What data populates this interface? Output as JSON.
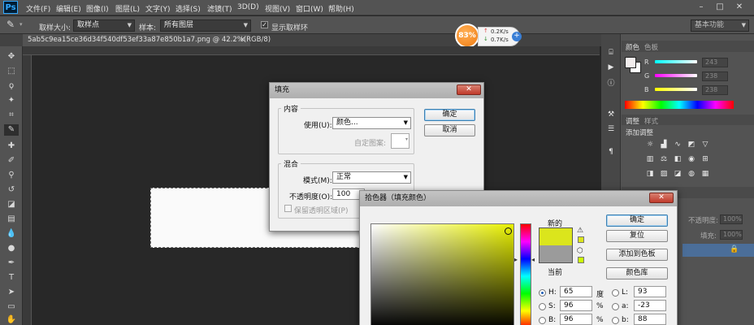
{
  "menubar": {
    "logo": "Ps",
    "items": [
      "文件(F)",
      "编辑(E)",
      "图像(I)",
      "图层(L)",
      "文字(Y)",
      "选择(S)",
      "滤镜(T)",
      "3D(D)",
      "视图(V)",
      "窗口(W)",
      "帮助(H)"
    ],
    "window_controls": [
      "–",
      "□",
      "✕"
    ]
  },
  "options_bar": {
    "sample_size_label": "取样大小:",
    "sample_size_value": "取样点",
    "sample_label": "样本:",
    "sample_value": "所有图层",
    "show_ring_label": "显示取样环",
    "workspace_value": "基本功能"
  },
  "document_tab": {
    "title": "5ab5c9ea15ce36d34f540df53ef33a87e850b1a7.png @ 42.2%(RGB/8)",
    "close": "×"
  },
  "net_widget": {
    "percent": "83%",
    "up": "0.2K/s",
    "down": "0.7K/s",
    "plus": "+"
  },
  "color_panel": {
    "tabs": [
      "颜色",
      "色板"
    ],
    "channels": [
      {
        "name": "R",
        "value": "243"
      },
      {
        "name": "G",
        "value": "238"
      },
      {
        "name": "B",
        "value": "238"
      }
    ]
  },
  "adjust_panel": {
    "tabs": [
      "调整",
      "样式"
    ],
    "title": "添加调整"
  },
  "layers_panel": {
    "opacity_label": "不透明度:",
    "opacity_value": "100%",
    "fill_label": "填充:",
    "fill_value": "100%"
  },
  "fill_dialog": {
    "title": "填充",
    "content_legend": "内容",
    "use_label": "使用(U):",
    "use_value": "颜色...",
    "pattern_label": "自定图案:",
    "blend_legend": "混合",
    "mode_label": "模式(M):",
    "mode_value": "正常",
    "opacity_label": "不透明度(O):",
    "opacity_value": "100",
    "opacity_unit": "%",
    "preserve_label": "保留透明区域(P)",
    "ok": "确定",
    "cancel": "取消"
  },
  "picker_dialog": {
    "title": "拾色器（填充颜色）",
    "new_label": "新的",
    "current_label": "当前",
    "new_color": "#dbe51c",
    "current_color": "#9b9b9b",
    "ok": "确定",
    "reset": "复位",
    "add_swatch": "添加到色板",
    "color_lib": "颜色库",
    "fields": [
      {
        "key": "H:",
        "value": "65",
        "unit": "度",
        "checked": true
      },
      {
        "key": "S:",
        "value": "96",
        "unit": "%",
        "checked": false
      },
      {
        "key": "B:",
        "value": "96",
        "unit": "%",
        "checked": false
      }
    ],
    "lab_fields": [
      {
        "key": "L:",
        "value": "93"
      },
      {
        "key": "a:",
        "value": "-23"
      },
      {
        "key": "b:",
        "value": "88"
      }
    ]
  },
  "colors": {
    "fg": "#f3eeee",
    "bg": "#ffffff",
    "hue": "#e8f000"
  }
}
